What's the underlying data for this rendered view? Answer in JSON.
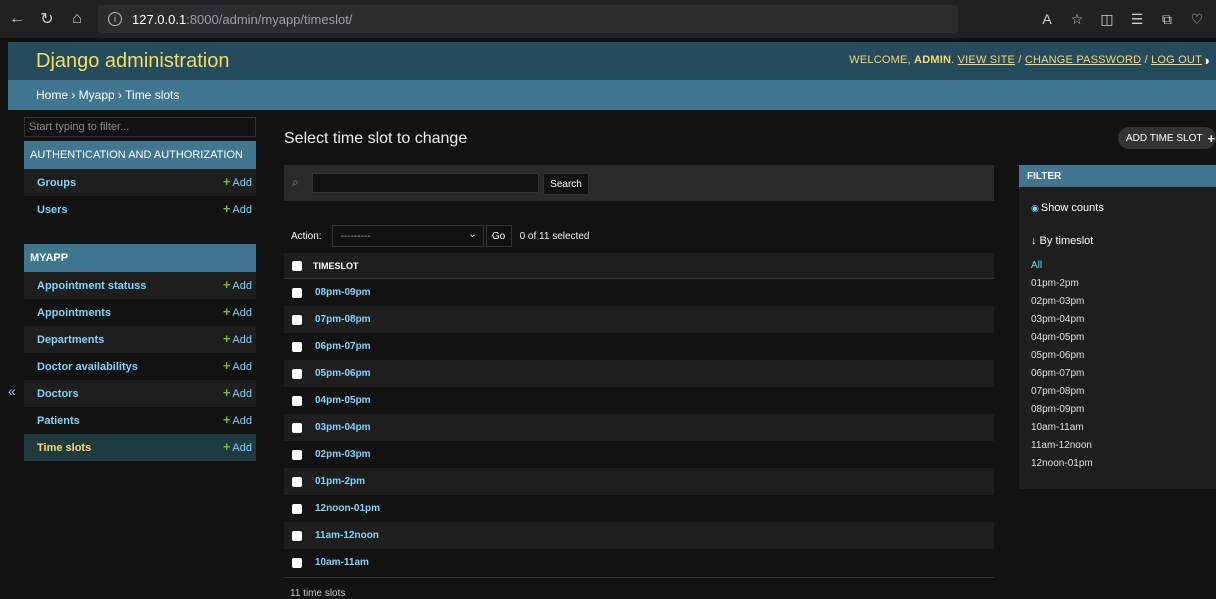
{
  "browser": {
    "url_host": "127.0.0.1",
    "url_path": ":8000/admin/myapp/timeslot/"
  },
  "header": {
    "branding": "Django administration",
    "welcome": "WELCOME, ",
    "user": "ADMIN",
    "view_site": "VIEW SITE",
    "change_password": "CHANGE PASSWORD",
    "log_out": "LOG OUT"
  },
  "breadcrumbs": "Home › Myapp › Time slots",
  "sidebar": {
    "filter_placeholder": "Start typing to filter...",
    "auth_caption": "AUTHENTICATION AND AUTHORIZATION",
    "auth_models": [
      {
        "label": "Groups",
        "add": "Add"
      },
      {
        "label": "Users",
        "add": "Add"
      }
    ],
    "app_caption": "MYAPP",
    "app_models": [
      {
        "label": "Appointment statuss",
        "add": "Add"
      },
      {
        "label": "Appointments",
        "add": "Add"
      },
      {
        "label": "Departments",
        "add": "Add"
      },
      {
        "label": "Doctor availabilitys",
        "add": "Add"
      },
      {
        "label": "Doctors",
        "add": "Add"
      },
      {
        "label": "Patients",
        "add": "Add"
      },
      {
        "label": "Time slots",
        "add": "Add"
      }
    ],
    "collapse": "«"
  },
  "main": {
    "title": "Select time slot to change",
    "add_button": "ADD TIME SLOT",
    "search_button": "Search",
    "action_label": "Action:",
    "action_selected": "---------",
    "go_button": "Go",
    "action_counter": "0 of 11 selected",
    "column_header": "TIMESLOT",
    "rows": [
      "08pm-09pm",
      "07pm-08pm",
      "06pm-07pm",
      "05pm-06pm",
      "04pm-05pm",
      "03pm-04pm",
      "02pm-03pm",
      "01pm-2pm",
      "12noon-01pm",
      "11am-12noon",
      "10am-11am"
    ],
    "paginator": "11 time slots"
  },
  "filter": {
    "title": "FILTER",
    "show_counts": "Show counts",
    "by_title": "↓ By timeslot",
    "options": [
      "All",
      "01pm-2pm",
      "02pm-03pm",
      "03pm-04pm",
      "04pm-05pm",
      "05pm-06pm",
      "06pm-07pm",
      "07pm-08pm",
      "08pm-09pm",
      "10am-11am",
      "11am-12noon",
      "12noon-01pm"
    ]
  },
  "colors": {
    "header_bg": "#264b5d",
    "accent": "#417690",
    "link": "#81d4fa",
    "brand_yellow": "#f5dd5d",
    "add_green": "#70bf2b"
  }
}
